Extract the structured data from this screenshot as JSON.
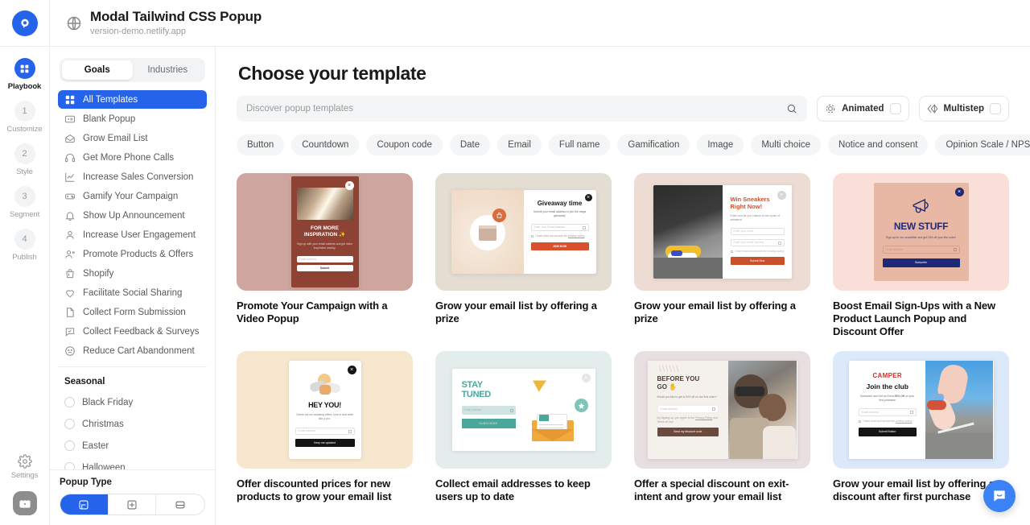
{
  "topbar": {
    "site_title": "Modal Tailwind CSS Popup",
    "site_url": "version-demo.netlify.app",
    "logo_icon": "popupsmart-logo-icon",
    "globe_icon": "globe-icon"
  },
  "rail": {
    "items": [
      {
        "label": "Playbook",
        "badge": "",
        "icon": "grid-icon",
        "active": true
      },
      {
        "label": "Customize",
        "badge": "1",
        "icon": "step-badge",
        "active": false
      },
      {
        "label": "Style",
        "badge": "2",
        "icon": "step-badge",
        "active": false
      },
      {
        "label": "Segment",
        "badge": "3",
        "icon": "step-badge",
        "active": false
      },
      {
        "label": "Publish",
        "badge": "4",
        "icon": "step-badge",
        "active": false
      }
    ],
    "settings_label": "Settings",
    "settings_icon": "gear-icon",
    "avatar_icon": "briefcase-icon"
  },
  "sidebar": {
    "tabs": [
      {
        "label": "Goals",
        "active": true
      },
      {
        "label": "Industries",
        "active": false
      }
    ],
    "items": [
      {
        "label": "All Templates",
        "icon": "grid-icon",
        "active": true
      },
      {
        "label": "Blank Popup",
        "icon": "blank-popup-icon",
        "active": false
      },
      {
        "label": "Grow Email List",
        "icon": "envelope-icon",
        "active": false
      },
      {
        "label": "Get More Phone Calls",
        "icon": "headset-icon",
        "active": false
      },
      {
        "label": "Increase Sales Conversion",
        "icon": "chart-line-icon",
        "active": false
      },
      {
        "label": "Gamify Your Campaign",
        "icon": "gamepad-icon",
        "active": false
      },
      {
        "label": "Show Up Announcement",
        "icon": "bell-icon",
        "active": false
      },
      {
        "label": "Increase User Engagement",
        "icon": "user-icon",
        "active": false
      },
      {
        "label": "Promote Products & Offers",
        "icon": "user-megaphone-icon",
        "active": false
      },
      {
        "label": "Shopify",
        "icon": "shopping-bag-icon",
        "active": false
      },
      {
        "label": "Facilitate Social Sharing",
        "icon": "heart-icon",
        "active": false
      },
      {
        "label": "Collect Form Submission",
        "icon": "document-icon",
        "active": false
      },
      {
        "label": "Collect Feedback & Surveys",
        "icon": "chat-check-icon",
        "active": false
      },
      {
        "label": "Reduce Cart Abandonment",
        "icon": "sad-face-icon",
        "active": false
      }
    ],
    "seasonal": {
      "title": "Seasonal",
      "items": [
        {
          "label": "Black Friday"
        },
        {
          "label": "Christmas"
        },
        {
          "label": "Easter"
        },
        {
          "label": "Halloween"
        }
      ]
    },
    "popup_type": {
      "title": "Popup Type",
      "options": [
        {
          "icon": "modal-popup-icon",
          "active": true
        },
        {
          "icon": "fullscreen-popup-icon",
          "active": false
        },
        {
          "icon": "bar-popup-icon",
          "active": false
        }
      ]
    }
  },
  "main": {
    "title": "Choose your template",
    "search": {
      "placeholder": "Discover popup templates",
      "value": "",
      "icon": "search-icon"
    },
    "toggles": [
      {
        "label": "Animated",
        "icon": "animated-icon",
        "checked": false
      },
      {
        "label": "Multistep",
        "icon": "multistep-icon",
        "checked": false
      }
    ],
    "chips": [
      "Button",
      "Countdown",
      "Coupon code",
      "Date",
      "Email",
      "Full name",
      "Gamification",
      "Image",
      "Multi choice",
      "Notice and consent",
      "Opinion Scale / NPS"
    ],
    "chip_next_icon": "chevron-right-icon",
    "templates": [
      {
        "title": "Promote Your Campaign with a Video Popup",
        "bg": "#cfa69f",
        "popup_bg": "#8e4233",
        "heading": "FOR MORE INSPIRATION ✨",
        "body": "Sign up with your email address and get video inspiration weekly.",
        "field_placeholder": "Email Address",
        "button_label": "Submit",
        "layout": "portrait-image-top"
      },
      {
        "title": "Grow your email list by offering a prize",
        "bg": "#e4ddd2",
        "popup_bg": "#ffffff",
        "heading": "Giveaway time",
        "body": "Submit your email address to join the mega giveaway!",
        "field_placeholder": "Enter Your Email Address",
        "consent": "I have read and accept the privacy policy",
        "button_label": "JOIN NOW",
        "accent": "#d9512c",
        "layout": "split-image-left"
      },
      {
        "title": "Grow your email list by offering a prize",
        "bg": "#eddcd3",
        "popup_bg": "#ffffff",
        "heading": "Win Sneakers Right Now!",
        "body": "Enter now for you chance to win a pair of sneakers!",
        "field_placeholder": "Enter your name",
        "field2_placeholder": "Enter your email address",
        "consent": "I have read and accept the privacy policy",
        "button_label": "Submit Now",
        "accent": "#c8502d",
        "layout": "split-photo-left"
      },
      {
        "title": "Boost Email Sign-Ups with a New Product Launch Popup and Discount Offer",
        "bg": "#f9dfd7",
        "popup_bg": "#e8b8a4",
        "heading": "NEW STUFF",
        "body": "Sign up for our newsletter and get 15% off your first order!",
        "field_placeholder": "Email Address",
        "button_label": "Subscribe",
        "accent": "#1e2a78",
        "layout": "square-megaphone"
      },
      {
        "title": "Offer discounted prices for new products to grow your email list",
        "bg": "#f8e7cf",
        "popup_bg": "#ffffff",
        "heading": "HEY YOU!",
        "body": "Check out our amazing offers, tune in and slide like a pro.",
        "field_placeholder": "Email Address",
        "button_label": "Keep me updated",
        "accent": "#141414",
        "layout": "portrait-illustration-top"
      },
      {
        "title": "Collect email addresses to keep users up to date",
        "bg": "#e3eeec",
        "popup_bg": "#ffffff",
        "heading": "STAY TUNED",
        "field_placeholder": "Email address",
        "button_label": "SUBSCRIBE",
        "accent": "#4aa79b",
        "layout": "split-illustration-right"
      },
      {
        "title": "Offer a special discount on exit-intent and grow your email list",
        "bg": "#e8dfe0",
        "popup_bg": "#f4f0ec",
        "heading": "BEFORE YOU GO ✋",
        "body": "Would you like to get a 20% off on our first order?",
        "field_placeholder": "Email address",
        "consent": "By signing up, you agree to the Privacy Policy and Terms of Use",
        "button_label": "Send my discount code",
        "accent": "#6b4a3d",
        "layout": "split-photo-right"
      },
      {
        "title": "Grow your email list by offering a discount after first purchase",
        "bg": "#dbe9fb",
        "popup_bg": "#ffffff",
        "brand": "CAMPER",
        "heading": "Join the club",
        "body": "Subscribe and Get an Extra 25% Off on your first purchase",
        "field_placeholder": "Email Address",
        "consent": "I have read and accept the privacy policy",
        "button_label": "Submit Button",
        "accent": "#141414",
        "layout": "split-photo-right-2"
      }
    ],
    "chat_icon": "chat-bubble-icon"
  }
}
